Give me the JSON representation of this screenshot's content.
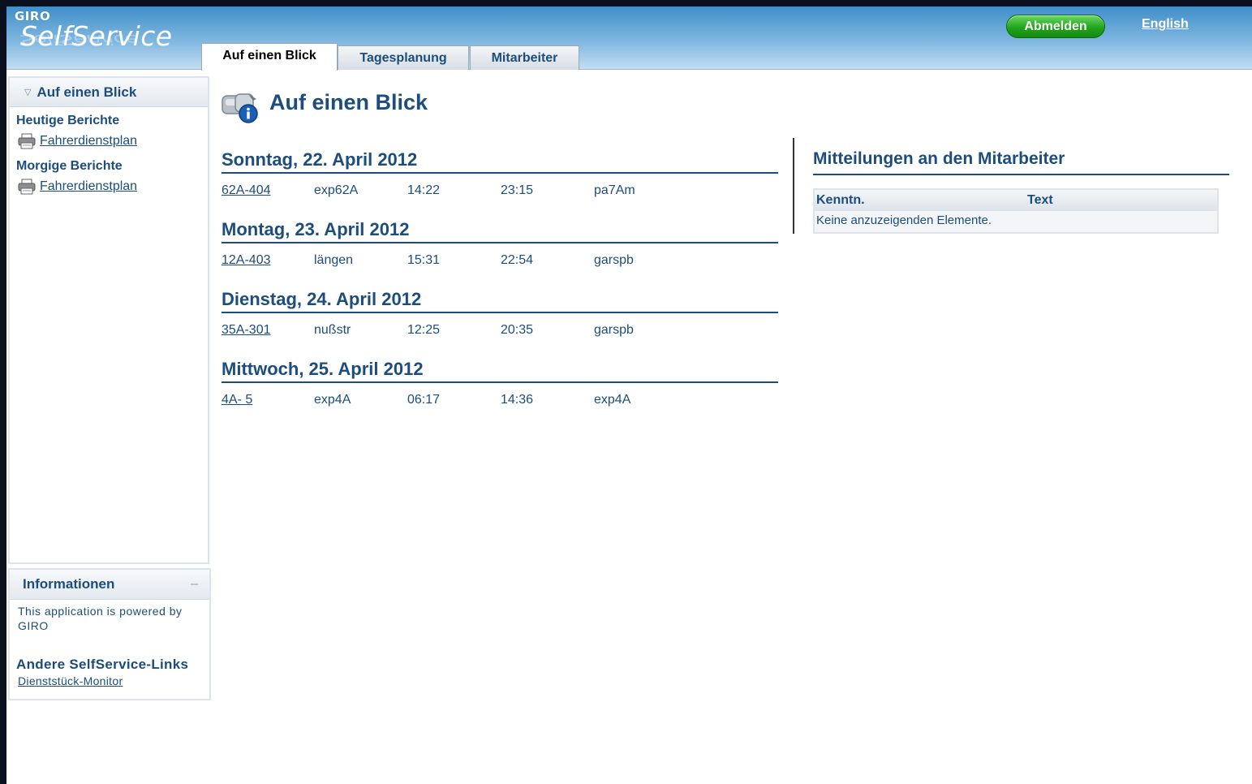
{
  "header": {
    "logo_small": "GIRO",
    "logo_main": "SelfService",
    "logout_label": "Abmelden",
    "language_link": "English"
  },
  "tabs": [
    {
      "label": "Auf einen Blick",
      "active": true
    },
    {
      "label": "Tagesplanung",
      "active": false
    },
    {
      "label": "Mitarbeiter",
      "active": false
    }
  ],
  "sidebar": {
    "title": "Auf einen Blick",
    "sections": [
      {
        "title": "Heutige Berichte",
        "link": "Fahrerdienstplan"
      },
      {
        "title": "Morgige Berichte",
        "link": "Fahrerdienstplan"
      }
    ]
  },
  "info_panel": {
    "title": "Informationen",
    "collapse_symbol": "–",
    "text": "This application is powered by GIRO",
    "other_links_title": "Andere SelfService-Links",
    "other_link": "Dienststück-Monitor"
  },
  "main": {
    "title": "Auf einen Blick",
    "days": [
      {
        "date": "Sonntag, 22. April 2012",
        "row": [
          "62A-404",
          "exp62A",
          "14:22",
          "23:15",
          "pa7Am"
        ]
      },
      {
        "date": "Montag, 23. April 2012",
        "row": [
          "12A-403",
          "längen",
          "15:31",
          "22:54",
          "garspb"
        ]
      },
      {
        "date": "Dienstag, 24. April 2012",
        "row": [
          "35A-301",
          "nußstr",
          "12:25",
          "20:35",
          "garspb"
        ]
      },
      {
        "date": "Mittwoch, 25. April 2012",
        "row": [
          "4A- 5",
          "exp4A",
          "06:17",
          "14:36",
          "exp4A"
        ]
      }
    ]
  },
  "messages": {
    "title": "Mitteilungen an den Mitarbeiter",
    "columns": [
      "Kenntn.",
      "Text"
    ],
    "empty_text": "Keine anzuzeigenden Elemente."
  },
  "colors": {
    "primary_text": "#1c4d7d",
    "header_blue": "#3f8ec8",
    "logout_green": "#22a51c"
  },
  "icons": [
    "printer-icon",
    "info-icon",
    "triangle-down-icon"
  ]
}
